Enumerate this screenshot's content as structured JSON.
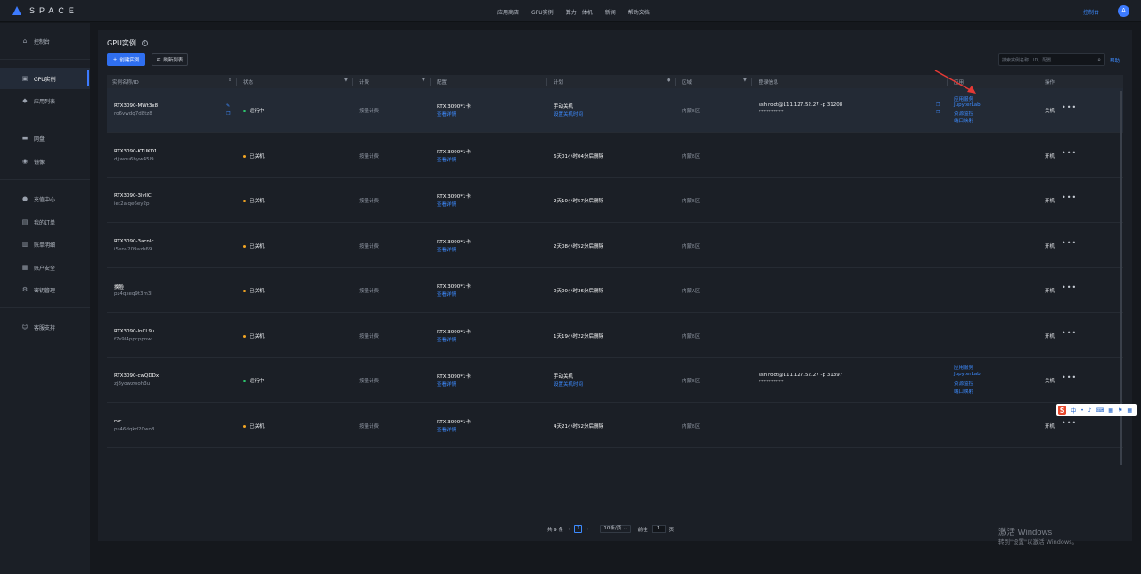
{
  "brand": {
    "name": "SPACE",
    "accent": "#3d7bff"
  },
  "topnav": {
    "items": [
      "应用商店",
      "GPU实例",
      "算力一体机",
      "新闻",
      "帮助文档"
    ],
    "console": "控制台",
    "avatar": "A"
  },
  "sidebar": {
    "items": [
      {
        "label": "控制台",
        "icon": "home-icon"
      },
      {
        "label": "GPU实例",
        "icon": "gpu-icon"
      },
      {
        "label": "应用列表",
        "icon": "cube-icon"
      },
      {
        "label": "网盘",
        "icon": "disk-icon"
      },
      {
        "label": "镜像",
        "icon": "image-icon"
      },
      {
        "label": "充值中心",
        "icon": "recharge-icon"
      },
      {
        "label": "我的订单",
        "icon": "order-icon"
      },
      {
        "label": "账单明细",
        "icon": "bill-icon"
      },
      {
        "label": "账户安全",
        "icon": "security-icon"
      },
      {
        "label": "密钥管理",
        "icon": "key-icon"
      },
      {
        "label": "客服支持",
        "icon": "support-icon"
      }
    ]
  },
  "page": {
    "title": "GPU实例",
    "create_btn": "创建实例",
    "refresh_btn": "刷新列表",
    "search_placeholder": "搜索实例名称、ID、配置",
    "help": "帮助"
  },
  "table": {
    "headers": [
      "实例名称/ID",
      "状态",
      "计费",
      "配置",
      "计划",
      "区域",
      "登录信息",
      "应用",
      "操作"
    ],
    "rows": [
      {
        "name": "RTX3090-MWt3x8",
        "id": "ro6vwdq7d8tz8",
        "status": "运行中",
        "state": "run",
        "billing": "按量计费",
        "config": "RTX 3090*1卡",
        "config_link": "查看详情",
        "plan": "手动关机",
        "plan_link": "设置关机时间",
        "region": "内蒙B区",
        "login": "ssh root@111.127.52.27 -p 31208",
        "password": "**********",
        "apps": [
          "应用服务",
          "JupyterLab",
          "资源监控",
          "端口映射"
        ],
        "action": "关机"
      },
      {
        "name": "RTX3090-KTUKD1",
        "id": "djjwou6hyw45l9",
        "status": "已关机",
        "state": "off",
        "billing": "按量计费",
        "config": "RTX 3090*1卡",
        "config_link": "查看详情",
        "plan": "6天01小时04分后删除",
        "plan_link": "",
        "region": "内蒙B区",
        "login": "",
        "password": "",
        "apps": [],
        "action": "开机"
      },
      {
        "name": "RTX3090-3lvllC",
        "id": "iet2alqe6ey2p",
        "status": "已关机",
        "state": "off",
        "billing": "按量计费",
        "config": "RTX 3090*1卡",
        "config_link": "查看详情",
        "plan": "2天10小时57分后删除",
        "plan_link": "",
        "region": "内蒙B区",
        "login": "",
        "password": "",
        "apps": [],
        "action": "开机"
      },
      {
        "name": "RTX3090-3acnlc",
        "id": "i5env209azh69",
        "status": "已关机",
        "state": "off",
        "billing": "按量计费",
        "config": "RTX 3090*1卡",
        "config_link": "查看详情",
        "plan": "2天08小时52分后删除",
        "plan_link": "",
        "region": "内蒙B区",
        "login": "",
        "password": "",
        "apps": [],
        "action": "开机"
      },
      {
        "name": "换脸",
        "id": "pz4qxeq9t3m3l",
        "status": "已关机",
        "state": "off",
        "billing": "按量计费",
        "config": "RTX 3090*1卡",
        "config_link": "查看详情",
        "plan": "0天00小时36分后删除",
        "plan_link": "",
        "region": "内蒙A区",
        "login": "",
        "password": "",
        "apps": [],
        "action": "开机"
      },
      {
        "name": "RTX3090-lnCL9u",
        "id": "f7s9l4ppcppnw",
        "status": "已关机",
        "state": "off",
        "billing": "按量计费",
        "config": "RTX 3090*1卡",
        "config_link": "查看详情",
        "plan": "1天19小时22分后删除",
        "plan_link": "",
        "region": "内蒙B区",
        "login": "",
        "password": "",
        "apps": [],
        "action": "开机"
      },
      {
        "name": "RTX3090-cwQDDx",
        "id": "zj8yowzwoh3u",
        "status": "运行中",
        "state": "run",
        "billing": "按量计费",
        "config": "RTX 3090*1卡",
        "config_link": "查看详情",
        "plan": "手动关机",
        "plan_link": "设置关机时间",
        "region": "内蒙B区",
        "login": "ssh root@111.127.52.27 -p 31397",
        "password": "**********",
        "apps": [
          "应用服务",
          "JupyterLab",
          "资源监控",
          "端口映射"
        ],
        "action": "关机"
      },
      {
        "name": "rvc",
        "id": "pz46dqkd20wo8",
        "status": "已关机",
        "state": "off",
        "billing": "按量计费",
        "config": "RTX 3090*1卡",
        "config_link": "查看详情",
        "plan": "4天21小时52分后删除",
        "plan_link": "",
        "region": "内蒙B区",
        "login": "",
        "password": "",
        "apps": [],
        "action": "开机"
      }
    ]
  },
  "pagination": {
    "total": "共 9 条",
    "current": "1",
    "page_size": "10条/页",
    "goto_label": "前往",
    "goto_value": "1",
    "page_suffix": "页"
  },
  "ime": {
    "logo": "S",
    "glyphs": [
      "中",
      "•",
      "♪",
      "⌨",
      "▦",
      "⚑",
      "▦"
    ]
  },
  "watermark": {
    "line1": "激活 Windows",
    "line2": "转到\"设置\"以激活 Windows。"
  }
}
